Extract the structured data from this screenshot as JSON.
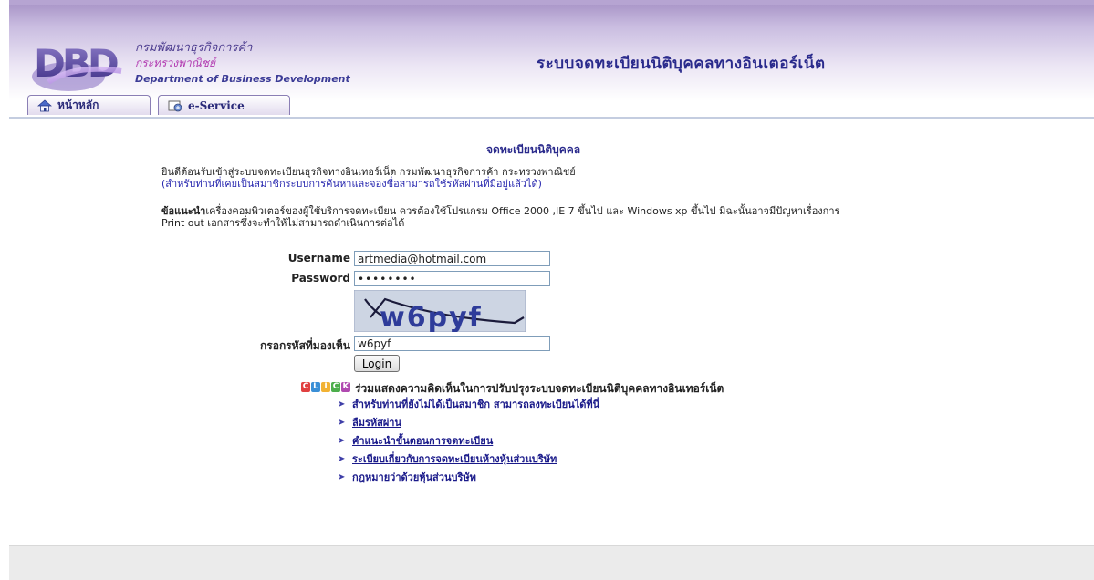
{
  "header": {
    "logo_org_thai": "กรมพัฒนาธุรกิจการค้า",
    "logo_ministry_thai": "กระทรวงพาณิชย์",
    "logo_org_english": "Department of Business Development",
    "site_title": "ระบบจดทะเบียนนิติบุคคลทางอินเตอร์เน็ต",
    "tabs": [
      {
        "label": "หน้าหลัก",
        "icon": "home-icon"
      },
      {
        "label": "e-Service",
        "icon": "eservice-icon"
      }
    ]
  },
  "main": {
    "heading": "จดทะเบียนนิติบุคคล",
    "welcome_line1": "ยินดีต้อนรับเข้าสู่ระบบจดทะเบียนธุรกิจทางอินเทอร์เน็ต กรมพัฒนาธุรกิจการค้า กระทรวงพาณิชย์",
    "welcome_line2": "(สำหรับท่านที่เคยเป็นสมาชิกระบบการค้นหาและจองชื่อสามารถใช้รหัสผ่านที่มีอยู่แล้วได้)",
    "advice_bold": "ข้อแนะนำ",
    "advice_text": "เครื่องคอมพิวเตอร์ของผู้ใช้บริการจดทะเบียน ควรต้องใช้โปรแกรม Office 2000 ,IE 7 ขึ้นไป และ Windows xp ขึ้นไป มิฉะนั้นอาจมีปัญหาเรื่องการ",
    "advice_text2": "Print out เอกสารซึ่งจะทำให้ไม่สามารถดำเนินการต่อได้"
  },
  "login": {
    "username_label": "Username",
    "username_value": "artmedia@hotmail.com",
    "password_label": "Password",
    "password_value": "••••••••",
    "captcha_text": "w6pyf",
    "captcha_label": "กรอกรหัสที่มองเห็น",
    "captcha_input_value": "w6pyf",
    "login_button": "Login"
  },
  "feedback": {
    "badge_letters": [
      "C",
      "L",
      "I",
      "C",
      "K"
    ],
    "badge_colors": [
      "#e04040",
      "#3a8fd6",
      "#f2b233",
      "#4cae4c",
      "#b04ab0"
    ],
    "text": "ร่วมแสดงความคิดเห็นในการปรับปรุงระบบจดทะเบียนนิติบุคคลทางอินเทอร์เน็ต"
  },
  "links": [
    "สำหรับท่านที่ยังไม่ได้เป็นสมาชิก สามารถลงทะเบียนได้ที่นี่",
    "ลืมรหัสผ่าน",
    "คำแนะนำขั้นตอนการจดทะเบียน",
    "ระเบียบเกี่ยวกับการจดทะเบียนห้างหุ้นส่วนบริษัท",
    "กฎหมายว่าด้วยหุ้นส่วนบริษัท"
  ],
  "colors": {
    "header_purple": "#a48fc4",
    "title_blue": "#2a2a8c",
    "link_blue": "#1a1a8a"
  }
}
